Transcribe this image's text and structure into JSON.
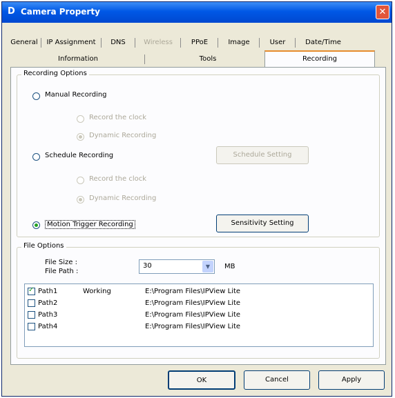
{
  "window": {
    "title": "Camera Property",
    "icon_letter": "D",
    "close_glyph": "✕"
  },
  "tabs": {
    "row1": [
      {
        "label": "General",
        "disabled": false
      },
      {
        "label": "IP Assignment",
        "disabled": false
      },
      {
        "label": "DNS",
        "disabled": false
      },
      {
        "label": "Wireless",
        "disabled": true
      },
      {
        "label": "PPoE",
        "disabled": false
      },
      {
        "label": "Image",
        "disabled": false
      },
      {
        "label": "User",
        "disabled": false
      },
      {
        "label": "Date/Time",
        "disabled": false
      }
    ],
    "row2": [
      {
        "label": "Information",
        "selected": false
      },
      {
        "label": "Tools",
        "selected": false
      },
      {
        "label": "Recording",
        "selected": true
      }
    ]
  },
  "recording_options": {
    "group_label": "Recording Options",
    "manual": {
      "label": "Manual Recording",
      "selected": false
    },
    "manual_sub": [
      {
        "label": "Record the clock",
        "selected": false
      },
      {
        "label": "Dynamic Recording",
        "selected": true
      }
    ],
    "schedule": {
      "label": "Schedule Recording",
      "selected": false
    },
    "schedule_button": "Schedule Setting",
    "schedule_sub": [
      {
        "label": "Record the clock",
        "selected": false
      },
      {
        "label": "Dynamic Recording",
        "selected": true
      }
    ],
    "motion": {
      "label": "Motion Trigger Recording",
      "selected": true
    },
    "sensitivity_button": "Sensitivity Setting"
  },
  "file_options": {
    "group_label": "File Options",
    "file_size_label": "File Size :",
    "file_path_label": "File Path :",
    "file_size_value": "30",
    "file_size_unit": "MB",
    "paths": [
      {
        "checked": true,
        "name": "Path1",
        "status": "Working",
        "path": "E:\\Program Files\\IPView Lite"
      },
      {
        "checked": false,
        "name": "Path2",
        "status": "",
        "path": "E:\\Program Files\\IPView Lite"
      },
      {
        "checked": false,
        "name": "Path3",
        "status": "",
        "path": "E:\\Program Files\\IPView Lite"
      },
      {
        "checked": false,
        "name": "Path4",
        "status": "",
        "path": "E:\\Program Files\\IPView Lite"
      }
    ]
  },
  "buttons": {
    "ok": "OK",
    "cancel": "Cancel",
    "apply": "Apply"
  }
}
